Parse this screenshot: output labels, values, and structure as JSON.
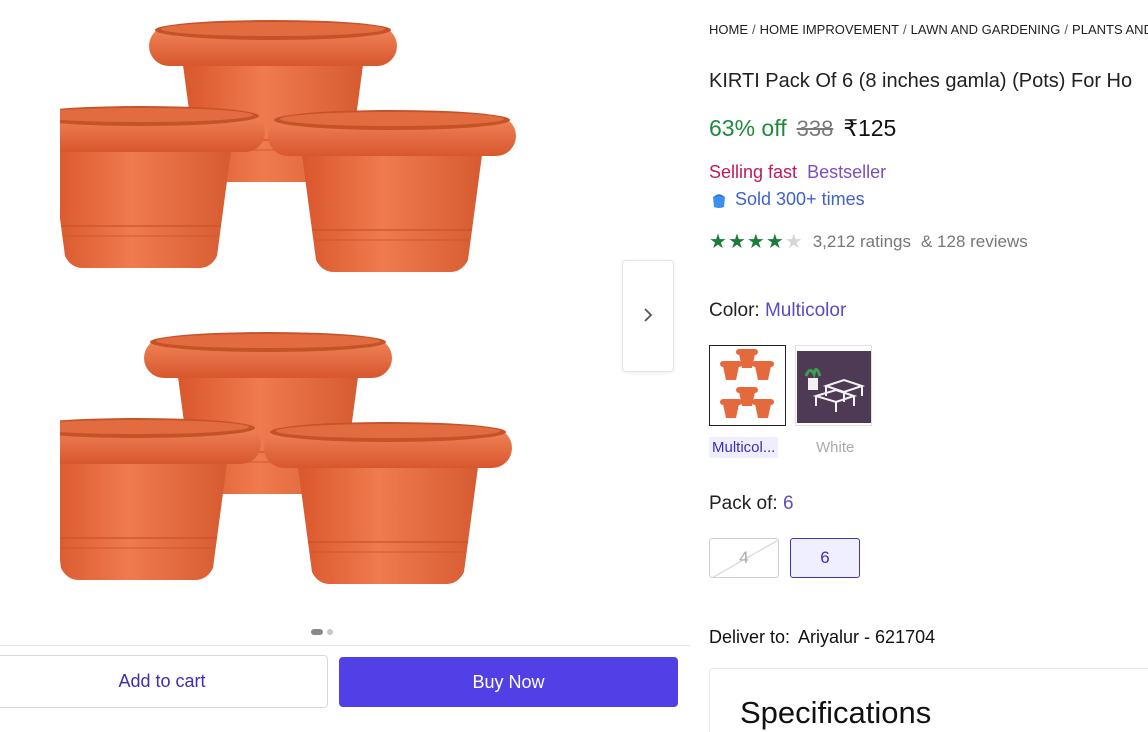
{
  "breadcrumb": [
    "HOME",
    "HOME IMPROVEMENT",
    "LAWN AND GARDENING",
    "PLANTS AND PL"
  ],
  "product": {
    "title": "KIRTI Pack Of 6 (8 inches gamla) (Pots) For Ho",
    "discount": "63% off",
    "mrp": "338",
    "price": "₹125",
    "badge_selling_fast": "Selling fast",
    "badge_bestseller": "Bestseller",
    "sold_text": "Sold 300+ times",
    "rating_stars": 4,
    "ratings_text": "3,212 ratings",
    "reviews_text": "& 128 reviews"
  },
  "color": {
    "label": "Color:",
    "value": "Multicolor",
    "options": [
      "Multicol...",
      "White"
    ]
  },
  "pack": {
    "label": "Pack of:",
    "value": "6",
    "options": [
      "4",
      "6"
    ]
  },
  "delivery": {
    "label": "Deliver to:",
    "location": "Ariyalur - 621704"
  },
  "specifications_title": "Specifications",
  "actions": {
    "add_to_cart": "Add to cart",
    "buy_now": "Buy Now"
  },
  "gallery": {
    "next_icon": "chevron-right-icon",
    "dots_total": 2,
    "dots_active": 1
  },
  "colors": {
    "primary": "#5140e6",
    "discount_green": "#1f8a3a",
    "pot_orange": "#e46a3e"
  }
}
